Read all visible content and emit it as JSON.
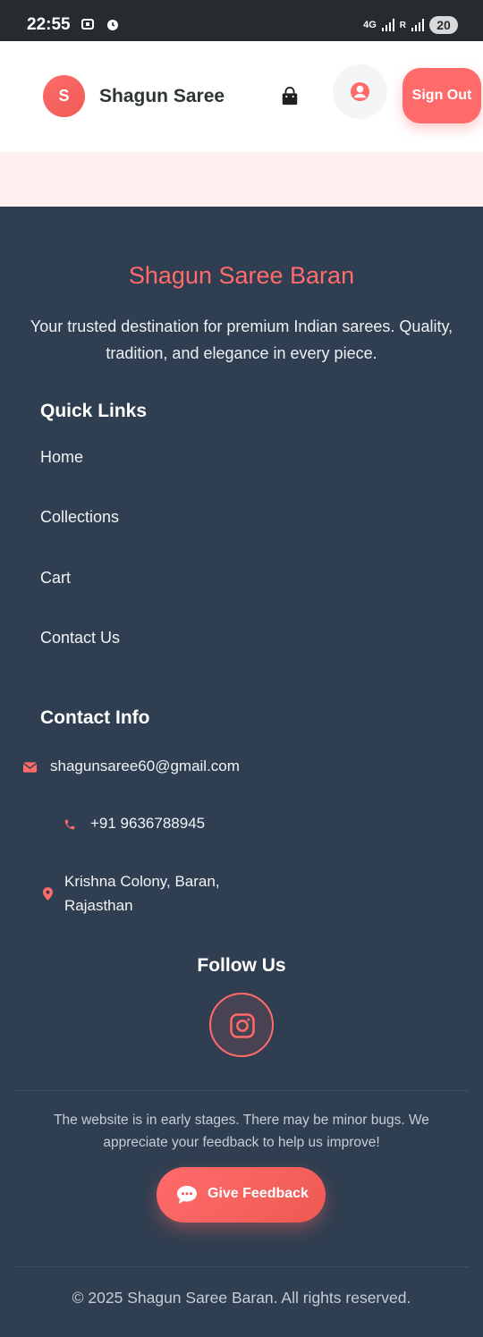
{
  "status_bar": {
    "time": "22:55",
    "network": "4G",
    "signal_label": "R",
    "battery": "20"
  },
  "header": {
    "logo_letter": "S",
    "brand": "Shagun Saree",
    "cart_icon": "shopping-bag-icon",
    "user_icon": "user-circle-icon",
    "sign_out": "Sign Out"
  },
  "footer": {
    "title": "Shagun Saree Baran",
    "description": "Your trusted destination for premium Indian sarees. Quality, tradition, and elegance in every piece.",
    "quick_links": {
      "heading": "Quick Links",
      "items": [
        "Home",
        "Collections",
        "Cart",
        "Contact Us"
      ]
    },
    "contact_info": {
      "heading": "Contact Info",
      "email": "shagunsaree60@gmail.com",
      "phone": "+91 9636788945",
      "address_line1": "Krishna Colony, Baran,",
      "address_line2": "Rajasthan"
    },
    "follow": {
      "heading": "Follow Us",
      "icon": "instagram-icon"
    },
    "notice": "The website is in early stages. There may be minor bugs. We appreciate your feedback to help us improve!",
    "feedback_button": "Give Feedback",
    "copyright": "© 2025 Shagun Saree Baran. All rights reserved."
  },
  "colors": {
    "accent": "#ff6b6b",
    "footer_bg": "#2f3e50",
    "header_bg": "#ffffff",
    "band_bg": "#fff1f2"
  }
}
